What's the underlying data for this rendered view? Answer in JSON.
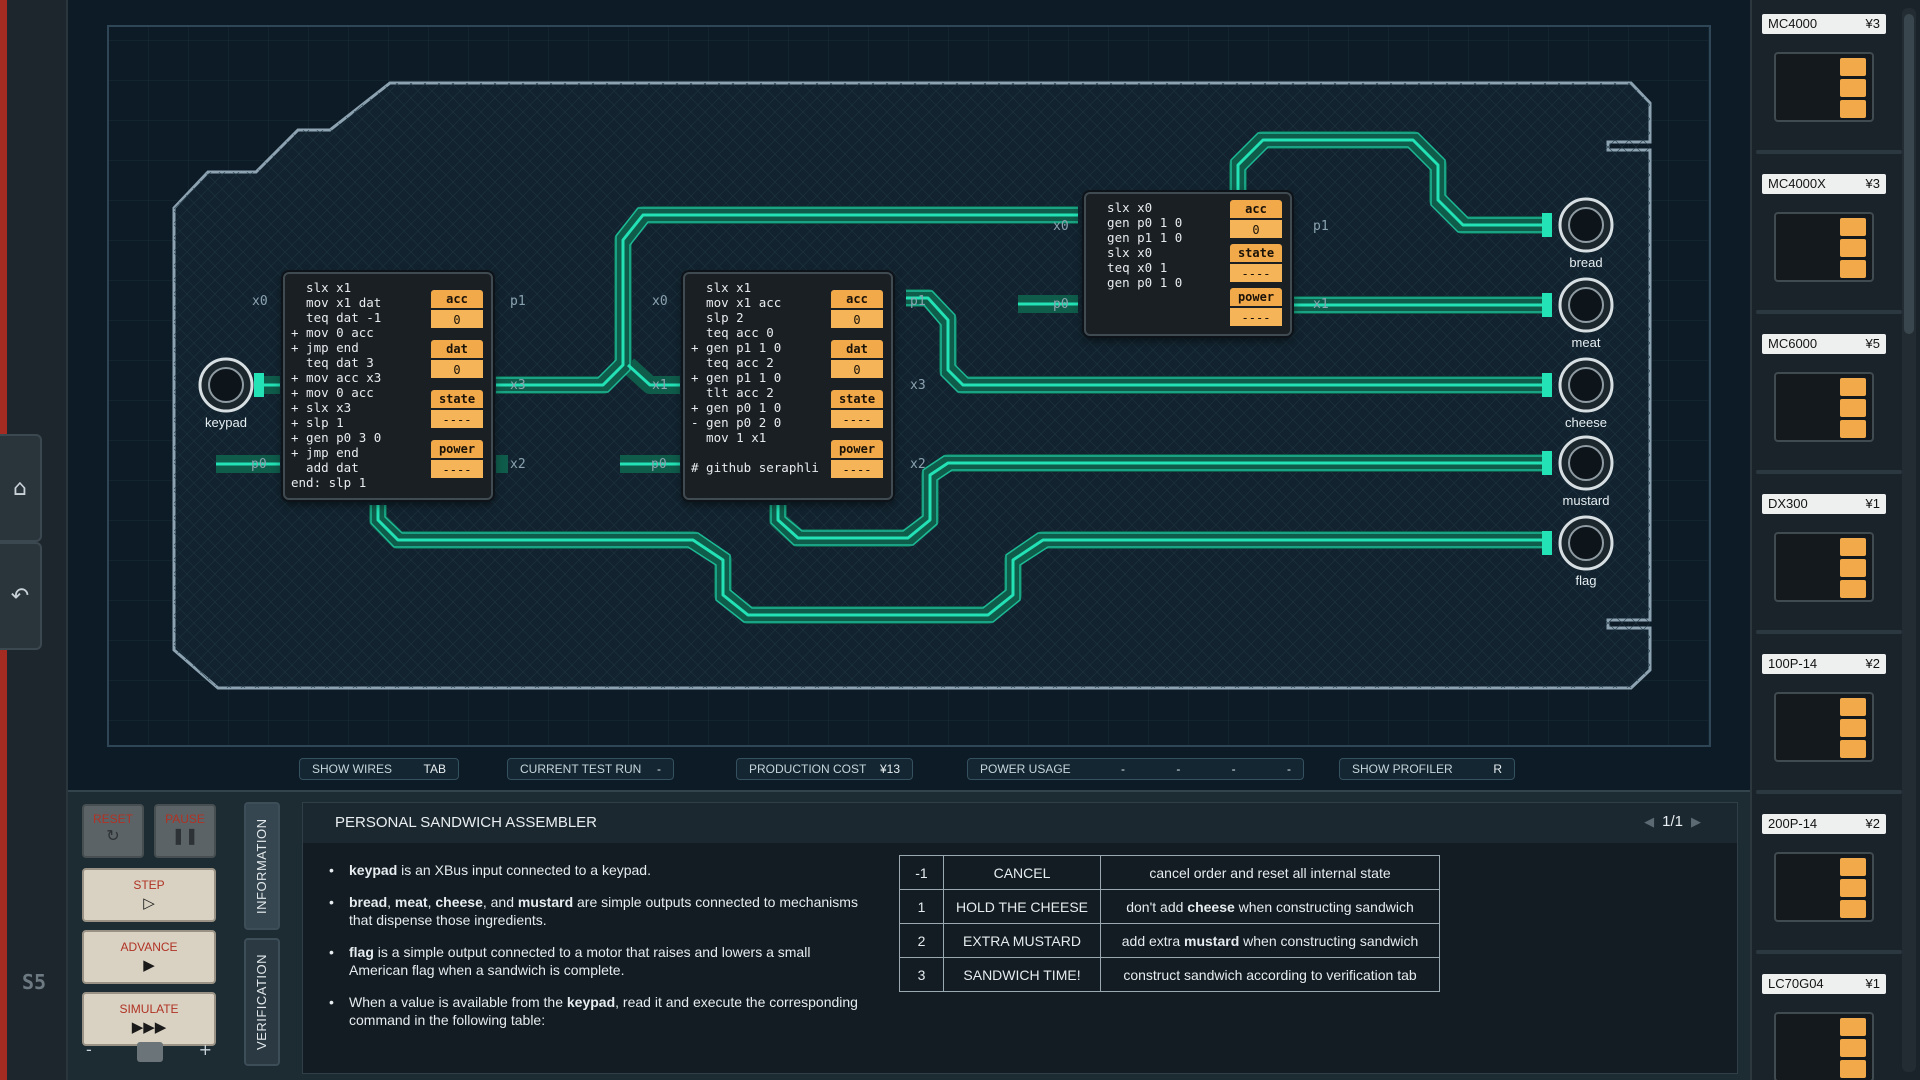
{
  "sidebar": {
    "home_icon": "home-icon",
    "undo_icon": "undo-icon",
    "logo_text": "S5"
  },
  "chips": [
    {
      "code": "  slx x1\n  mov x1 dat\n  teq dat -1\n+ mov 0 acc\n+ jmp end\n  teq dat 3\n+ mov acc x3\n+ mov 0 acc\n+ slx x3\n+ slp 1\n+ gen p0 3 0\n+ jmp end\n  add dat\nend: slp 1",
      "regs": [
        {
          "name": "acc",
          "value": "0"
        },
        {
          "name": "dat",
          "value": "0"
        },
        {
          "name": "state",
          "value": "----"
        },
        {
          "name": "power",
          "value": "----"
        }
      ],
      "ports": {
        "x0": "x0",
        "p1": "p1",
        "x3": "x3",
        "p0": "p0",
        "x2": "x2"
      }
    },
    {
      "code": "  slx x1\n  mov x1 acc\n  slp 2\n  teq acc 0\n+ gen p1 1 0\n  teq acc 2\n+ gen p1 1 0\n  tlt acc 2\n+ gen p0 1 0\n- gen p0 2 0\n  mov 1 x1\n\n# github seraphli",
      "regs": [
        {
          "name": "acc",
          "value": "0"
        },
        {
          "name": "dat",
          "value": "0"
        },
        {
          "name": "state",
          "value": "----"
        },
        {
          "name": "power",
          "value": "----"
        }
      ],
      "ports": {
        "x0": "x0",
        "p1": "p1",
        "x1": "x1",
        "x3": "x3",
        "p0": "p0",
        "x2": "x2"
      }
    },
    {
      "code": "  slx x0\n  gen p0 1 0\n  gen p1 1 0\n  slx x0\n  teq x0 1\n  gen p0 1 0",
      "regs": [
        {
          "name": "acc",
          "value": "0"
        },
        {
          "name": "state",
          "value": "----"
        },
        {
          "name": "power",
          "value": "----"
        }
      ],
      "ports": {
        "x0": "x0",
        "p1": "p1",
        "p0": "p0",
        "x1": "x1"
      }
    }
  ],
  "io": {
    "input": "keypad",
    "outputs": [
      "bread",
      "meat",
      "cheese",
      "mustard",
      "flag"
    ]
  },
  "stats": {
    "show_wires": "SHOW WIRES",
    "show_wires_key": "TAB",
    "current_test_run": "CURRENT TEST RUN",
    "current_test_run_value": "-",
    "production_cost": "PRODUCTION COST",
    "production_cost_value": "¥13",
    "power_usage": "POWER USAGE",
    "power_values": [
      "-",
      "-",
      "-",
      "-"
    ],
    "show_profiler": "SHOW PROFILER",
    "show_profiler_key": "R"
  },
  "controls": {
    "reset": "RESET",
    "pause": "PAUSE",
    "step": "STEP",
    "advance": "ADVANCE",
    "simulate": "SIMULATE",
    "reset_glyph": "↻",
    "pause_glyph": "❚❚",
    "step_glyph": "▷",
    "advance_glyph": "▶",
    "simulate_glyph": "▶▶▶",
    "speed_minus": "-",
    "speed_plus": "+"
  },
  "tabs": {
    "information": "INFORMATION",
    "verification": "VERIFICATION"
  },
  "info": {
    "title": "PERSONAL SANDWICH ASSEMBLER",
    "page": "1/1",
    "b1_bold": "keypad",
    "b1_rest": " is an XBus input connected to a keypad.",
    "b2_a": "bread",
    "b2_sep1": ", ",
    "b2_b": "meat",
    "b2_sep2": ", ",
    "b2_c": "cheese",
    "b2_sep3": ", and ",
    "b2_d": "mustard",
    "b2_rest": " are simple outputs connected to mechanisms that dispense those ingredients.",
    "b3_bold": "flag",
    "b3_rest": " is a simple output connected to a motor that raises and lowers a small American flag when a sandwich is complete.",
    "b4_pre": "When a value is available from the ",
    "b4_bold": "keypad",
    "b4_rest": ", read it and execute the corresponding command in the following table:",
    "table": [
      {
        "code": "-1",
        "name": "CANCEL",
        "pre": "cancel order and reset all internal state",
        "bold": "",
        "post": ""
      },
      {
        "code": "1",
        "name": "HOLD THE CHEESE",
        "pre": "don't add ",
        "bold": "cheese",
        "post": " when constructing sandwich"
      },
      {
        "code": "2",
        "name": "EXTRA MUSTARD",
        "pre": "add extra ",
        "bold": "mustard",
        "post": " when constructing sandwich"
      },
      {
        "code": "3",
        "name": "SANDWICH TIME!",
        "pre": "construct sandwich according to verification tab",
        "bold": "",
        "post": ""
      }
    ]
  },
  "palette": [
    {
      "name": "MC4000",
      "price": "¥3"
    },
    {
      "name": "MC4000X",
      "price": "¥3"
    },
    {
      "name": "MC6000",
      "price": "¥5"
    },
    {
      "name": "DX300",
      "price": "¥1"
    },
    {
      "name": "100P-14",
      "price": "¥2"
    },
    {
      "name": "200P-14",
      "price": "¥2"
    },
    {
      "name": "LC70G04",
      "price": "¥1"
    }
  ],
  "colors": {
    "wire": "#1ee0b4",
    "register": "#f2a94a",
    "alarm": "#b03224"
  }
}
